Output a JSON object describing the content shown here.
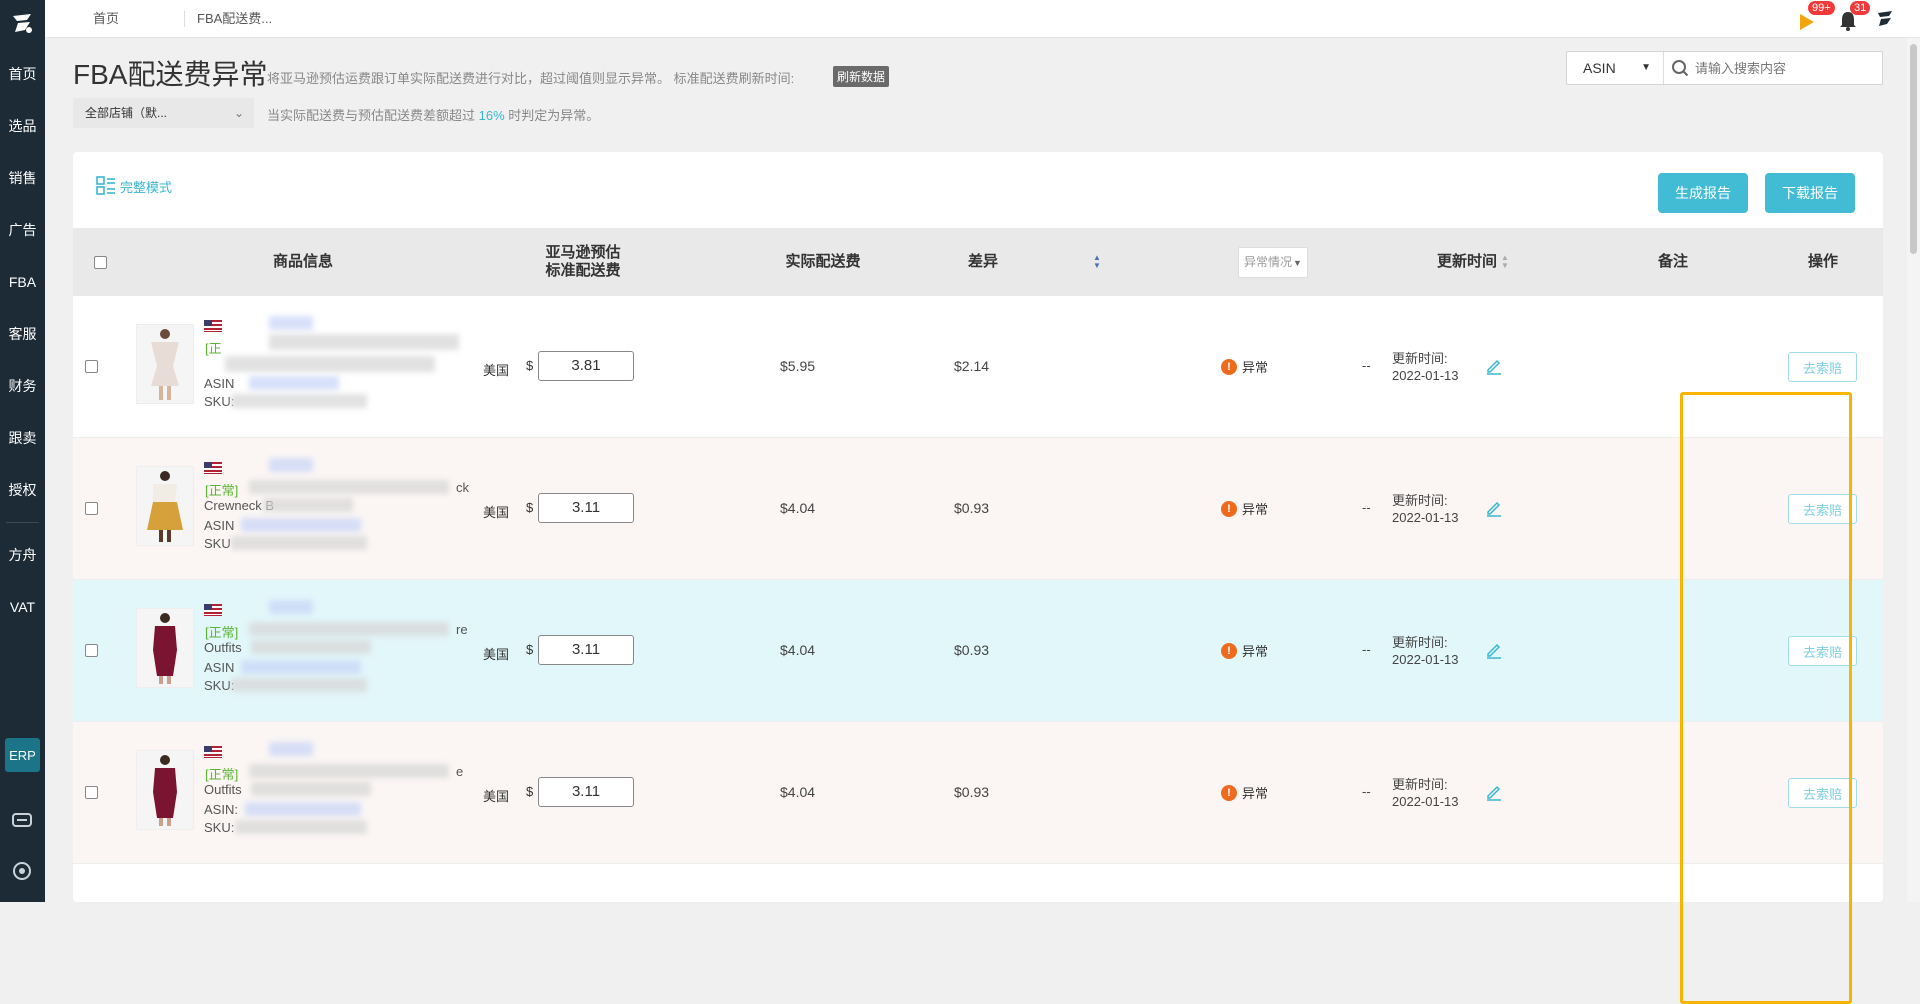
{
  "sidebar": {
    "items": [
      {
        "label": "首页"
      },
      {
        "label": "选品"
      },
      {
        "label": "销售"
      },
      {
        "label": "广告"
      },
      {
        "label": "FBA"
      },
      {
        "label": "客服"
      },
      {
        "label": "财务"
      },
      {
        "label": "跟卖"
      },
      {
        "label": "授权"
      }
    ],
    "items2": [
      {
        "label": "方舟"
      },
      {
        "label": "VAT"
      }
    ],
    "erp_label": "ERP"
  },
  "topbar": {
    "tab_home": "首页",
    "tab_current": "FBA配送费...",
    "flag_badge": "99+",
    "bell_badge": "31"
  },
  "header": {
    "title": "FBA配送费异常",
    "description": "将亚马逊预估运费跟订单实际配送费进行对比，超过阈值则显示异常。 标准配送费刷新时间:",
    "refresh_label": "刷新数据",
    "store_select": "全部店铺（默...",
    "hint_prefix": "当实际配送费与预估配送费差额超过",
    "hint_pct": "16%",
    "hint_suffix": "时判定为异常。"
  },
  "search": {
    "type": "ASIN",
    "placeholder": "请输入搜索内容"
  },
  "toolbar": {
    "mode_label": "完整模式",
    "generate_label": "生成报告",
    "download_label": "下载报告"
  },
  "table": {
    "headers": {
      "product": "商品信息",
      "est_fee_line1": "亚马逊预估",
      "est_fee_line2": "标准配送费",
      "actual_fee": "实际配送费",
      "diff": "差异",
      "abnormal_filter": "异常情况",
      "update_time": "更新时间",
      "note": "备注",
      "action": "操作"
    },
    "rows": [
      {
        "status_prefix": "[正",
        "line2": "",
        "asin_label": "ASIN",
        "sku_label": "SKU:",
        "country": "美国",
        "currency": "$",
        "est_fee": "3.81",
        "actual_fee": "$5.95",
        "diff": "$2.14",
        "abnormal": "异常",
        "update_label": "更新时间:",
        "update_date": "2022-01-13",
        "note": "--",
        "action": "去索赔"
      },
      {
        "status_prefix": "[正常]",
        "line2": "Crewneck B",
        "title_tail": "ck",
        "asin_label": "ASIN",
        "sku_label": "SKU",
        "country": "美国",
        "currency": "$",
        "est_fee": "3.11",
        "actual_fee": "$4.04",
        "diff": "$0.93",
        "abnormal": "异常",
        "update_label": "更新时间:",
        "update_date": "2022-01-13",
        "note": "--",
        "action": "去索赔"
      },
      {
        "status_prefix": "[正常]",
        "line2": "Outfits",
        "title_tail": "re",
        "asin_label": "ASIN",
        "sku_label": "SKU:",
        "country": "美国",
        "currency": "$",
        "est_fee": "3.11",
        "actual_fee": "$4.04",
        "diff": "$0.93",
        "abnormal": "异常",
        "update_label": "更新时间:",
        "update_date": "2022-01-13",
        "note": "--",
        "action": "去索赔"
      },
      {
        "status_prefix": "[正常]",
        "line2": "Outfits",
        "title_tail": "e",
        "asin_label": "ASIN:",
        "sku_label": "SKU:",
        "country": "美国",
        "currency": "$",
        "est_fee": "3.11",
        "actual_fee": "$4.04",
        "diff": "$0.93",
        "abnormal": "异常",
        "update_label": "更新时间:",
        "update_date": "2022-01-13",
        "note": "--",
        "action": "去索赔"
      }
    ]
  },
  "colors": {
    "sidebar_bg": "#1d2b36",
    "accent": "#42bbd5",
    "highlight_box": "#f8b400",
    "abnormal": "#ee6a1c",
    "status_ok": "#5ab631",
    "row_highlight": "#e2f7fa",
    "row_alt": "#fbf6f4"
  }
}
